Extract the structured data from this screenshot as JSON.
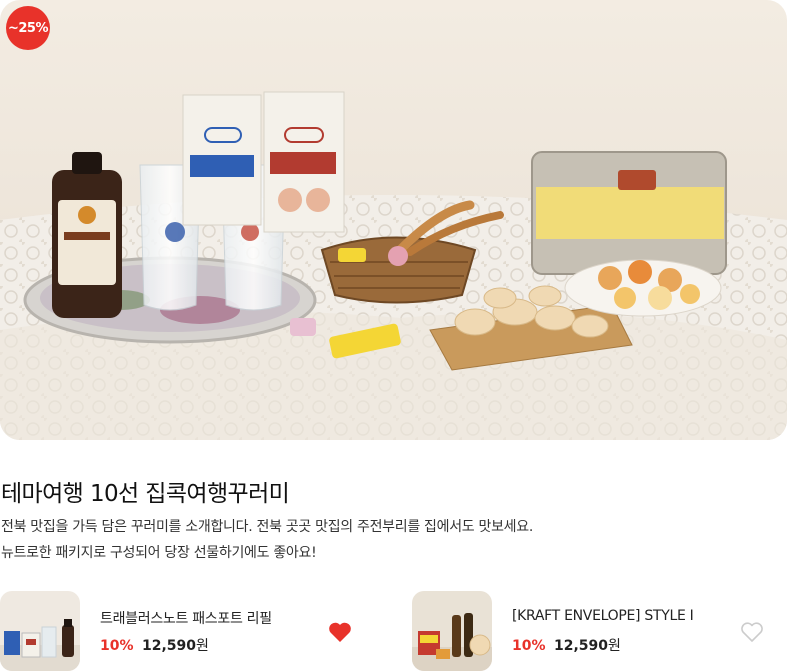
{
  "hero": {
    "discount_badge": "~25%",
    "image_alt": "집콕여행꾸러미 상품 이미지"
  },
  "theme": {
    "title": "테마여행 10선 집콕여행꾸러미",
    "description": [
      "전북 맛집을 가득 담은 꾸러미를 소개합니다. 전북 곳곳 맛집의 주전부리를 집에서도 맛보세요.",
      "뉴트로한 패키지로 구성되어 당장 선물하기에도 좋아요!"
    ]
  },
  "products": [
    {
      "name": "트래블러스노트 패스포트 리필",
      "discount": "10%",
      "price": "12,590",
      "currency": "원",
      "wishlisted": true,
      "heart_color": "#e8322a"
    },
    {
      "name": "[KRAFT ENVELOPE] STYLE I",
      "discount": "10%",
      "price": "12,590",
      "currency": "원",
      "wishlisted": false,
      "heart_color": "#cccccc"
    }
  ],
  "colors": {
    "accent": "#e8322a",
    "text": "#222222"
  }
}
